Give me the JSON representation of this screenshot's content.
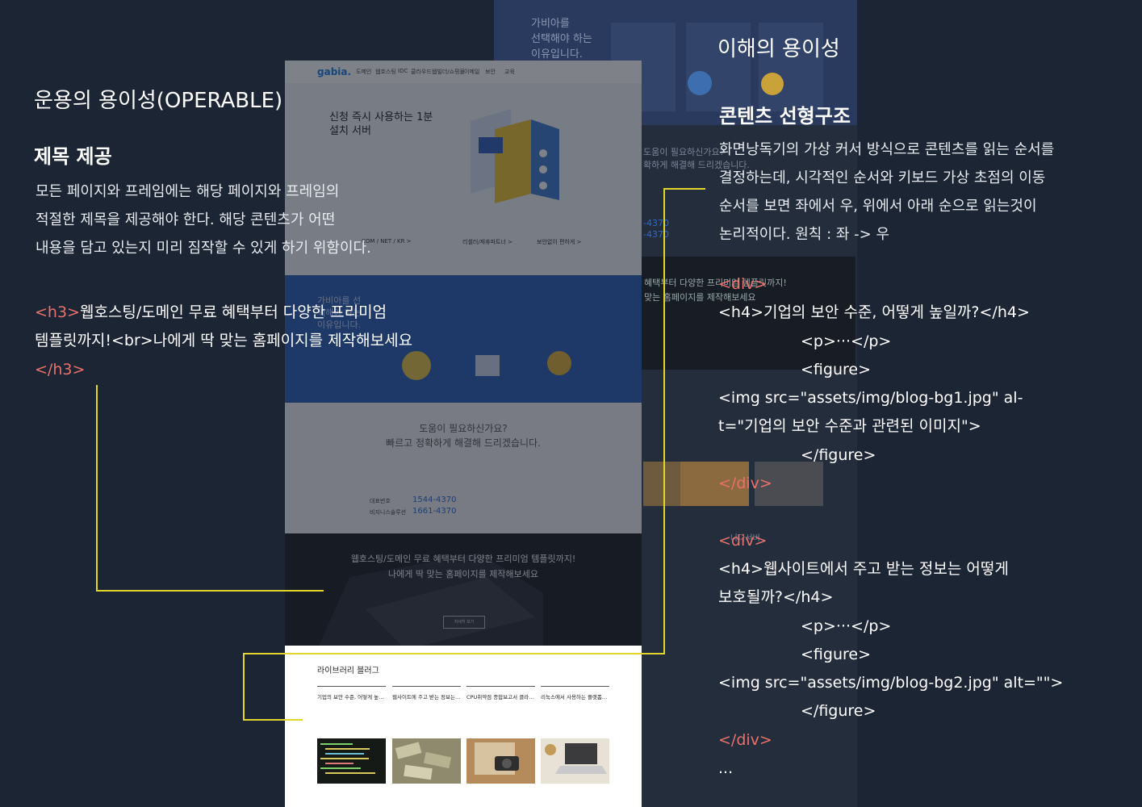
{
  "left_panel": {
    "section_title": "운용의 용이성(OPERABLE)",
    "sub_title": "제목 제공",
    "description_lines": [
      "모든 페이지와 프레임에는 해당 페이지와 프레임의",
      "적절한 제목을 제공해야 한다. 해당 콘텐츠가 어떤",
      "내용을 담고 있는지 미리 짐작할 수 있게 하기 위함이다."
    ],
    "code": {
      "open_tag": "<h3>",
      "text_1": "웹호스팅/도메인 무료 혜택부터 다양한 프리미엄",
      "text_2": "템플릿까지!<br>나에게 딱 맞는 홈페이지를 제작해보세요",
      "close_tag": "</h3>"
    }
  },
  "right_panel": {
    "section_title": "이해의 용이성",
    "sub_title": "콘텐츠 선형구조",
    "description_lines": [
      "화면낭독기의 가상 커서 방식으로 콘텐츠를 읽는 순서를",
      "결정하는데, 시각적인 순서와 키보드 가상 초점의 이동",
      "순서를 보면 좌에서 우, 위에서 아래 순으로 읽는것이",
      "논리적이다. 원칙 : 좌 -> 우"
    ],
    "code_lines": [
      {
        "text": "<div>",
        "type": "tag",
        "indent": false
      },
      {
        "text": "<h4>기업의 보안 수준, 어떻게 높일까?</h4>",
        "type": "code",
        "indent": false
      },
      {
        "text": "<p>···</p>",
        "type": "code",
        "indent": true
      },
      {
        "text": "<figure>",
        "type": "code",
        "indent": true
      },
      {
        "text": "<img src=\"assets/img/blog-bg1.jpg\" al-",
        "type": "code",
        "indent": false
      },
      {
        "text": "t=\"기업의 보안 수준과 관련된 이미지\">",
        "type": "code",
        "indent": false
      },
      {
        "text": "</figure>",
        "type": "code",
        "indent": true
      },
      {
        "text": "</div>",
        "type": "tag",
        "indent": false
      },
      {
        "text": "",
        "type": "blank",
        "indent": false
      },
      {
        "text": "<div>",
        "type": "tag",
        "indent": false
      },
      {
        "text": "<h4>웹사이트에서 주고 받는 정보는 어떻게",
        "type": "code",
        "indent": false
      },
      {
        "text": "보호될까?</h4>",
        "type": "code",
        "indent": false
      },
      {
        "text": "<p>···</p>",
        "type": "code",
        "indent": true
      },
      {
        "text": "<figure>",
        "type": "code",
        "indent": true
      },
      {
        "text": "<img src=\"assets/img/blog-bg2.jpg\" alt=\"\">",
        "type": "code",
        "indent": false
      },
      {
        "text": "</figure>",
        "type": "code",
        "indent": true
      },
      {
        "text": "</div>",
        "type": "tag",
        "indent": false
      },
      {
        "text": "...",
        "type": "code",
        "indent": false
      }
    ]
  },
  "site_screenshot": {
    "logo": "gabia.",
    "nav_items": [
      "도메인",
      "웹호스팅",
      "IDC",
      "클라우드",
      "웹빌더/쇼핑몰",
      "이메일",
      "보안",
      "교육"
    ],
    "hero_title": "신청 즉시 사용하는 1분 설치 서버",
    "hero_links": [
      "COM / NET / KR >",
      "리셀러/제휴파트너 >",
      "보안없이 편하게 >"
    ],
    "blue_band_title": "가비아를 선택해야 하는 이유입니다.",
    "help_title_1": "도움이 필요하신가요?",
    "help_title_2": "빠르고 정확하게 해결해 드리겠습니다.",
    "help_rows": [
      {
        "label": "대표번호",
        "number": "1544-4370"
      },
      {
        "label": "비지니스솔루션",
        "number": "1661-4370"
      }
    ],
    "promo_line_1": "웹호스팅/도메인 무료 혜택부터 다양한 프리미엄 템플릿까지!",
    "promo_line_2": "나에게 딱 맞는 홈페이지를 제작해보세요",
    "promo_button": "자세히 보기",
    "library_title": "라이브러리 블러그",
    "library_cards": [
      {
        "title": "기업의 보안 수준, 어떻게 높…",
        "thumb": "code-screen"
      },
      {
        "title": "웹사이트에 주고 받는 정보는…",
        "thumb": "money-pile"
      },
      {
        "title": "CPU취약점 종합보고서 클라…",
        "thumb": "camera-map"
      },
      {
        "title": "리눅스에서 사용하는 플랫폼…",
        "thumb": "laptop-desk"
      }
    ]
  },
  "colors": {
    "background": "#1c2534",
    "tag": "#e9716b",
    "connector": "#e2d62a",
    "brand_blue": "#2b5fb6"
  }
}
